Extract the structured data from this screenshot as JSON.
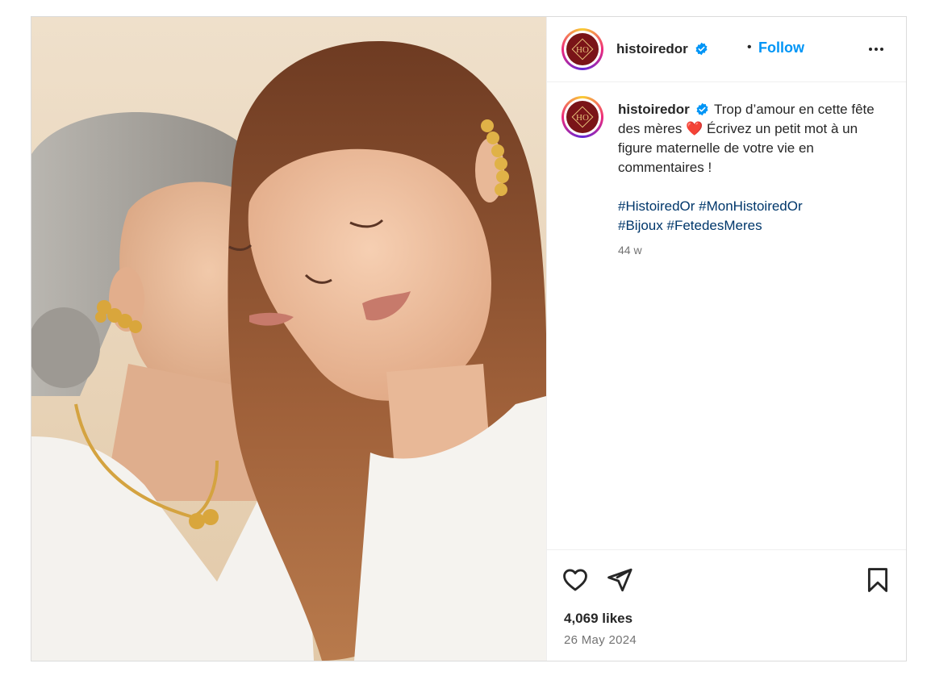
{
  "post": {
    "username": "histoiredor",
    "follow_label": "Follow",
    "separator": "•",
    "caption": {
      "text": "Trop d’amour en cette fête des mères ❤️ Écrivez un petit mot à un figure maternelle de votre vie en commentaires !",
      "hashtags": [
        "#HistoiredOr",
        "#MonHistoiredOr",
        "#Bijoux",
        "#FetedesMeres"
      ]
    },
    "age": "44 w",
    "likes": "4,069 likes",
    "date": "26 May 2024"
  },
  "icons": {
    "more": "more-options-icon",
    "verified": "verified-badge-icon",
    "like": "heart-icon",
    "share": "paper-plane-icon",
    "save": "bookmark-icon"
  },
  "colors": {
    "accent": "#0095f6",
    "hashtag": "#00376b",
    "brand": "#7a1418",
    "verified": "#0095f6"
  }
}
